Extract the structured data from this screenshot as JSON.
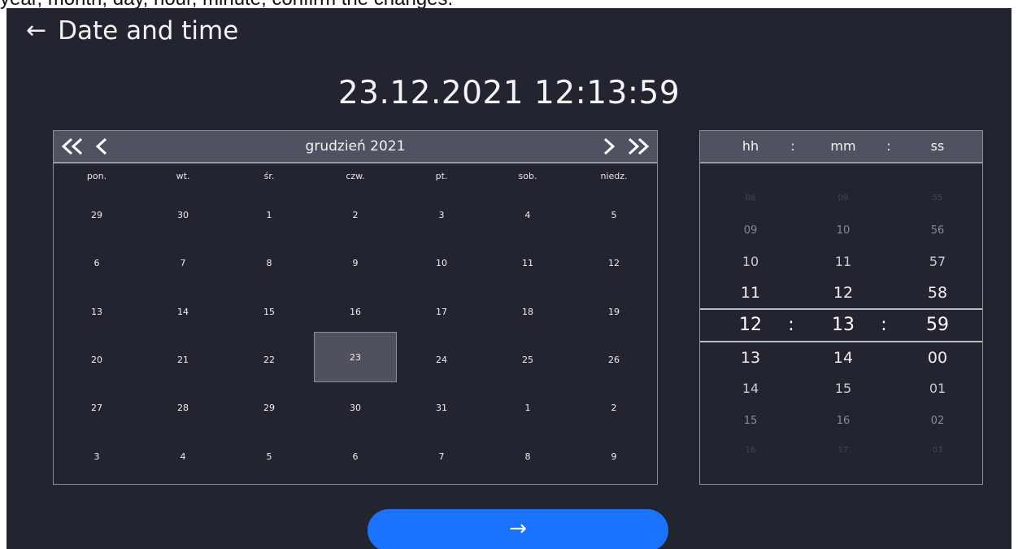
{
  "caption": "year, month, day, hour, minute, confirm the changes.",
  "header": {
    "back_icon": "←",
    "title": "Date and time"
  },
  "current_datetime": "23.12.2021 12:13:59",
  "calendar": {
    "month_label": "grudzień 2021",
    "weekdays": [
      "pon.",
      "wt.",
      "śr.",
      "czw.",
      "pt.",
      "sob.",
      "niedz."
    ],
    "days": [
      "29",
      "30",
      "1",
      "2",
      "3",
      "4",
      "5",
      "6",
      "7",
      "8",
      "9",
      "10",
      "11",
      "12",
      "13",
      "14",
      "15",
      "16",
      "17",
      "18",
      "19",
      "20",
      "21",
      "22",
      "23",
      "24",
      "25",
      "26",
      "27",
      "28",
      "29",
      "30",
      "31",
      "1",
      "2",
      "3",
      "4",
      "5",
      "6",
      "7",
      "8",
      "9"
    ],
    "selected_index": 24
  },
  "time": {
    "headers": {
      "hh": "hh",
      "mm": "mm",
      "ss": "ss",
      "sep": ":"
    },
    "rows": [
      [
        "08",
        "09",
        "55"
      ],
      [
        "09",
        "10",
        "56"
      ],
      [
        "10",
        "11",
        "57"
      ],
      [
        "11",
        "12",
        "58"
      ],
      [
        "12",
        "13",
        "59"
      ],
      [
        "13",
        "14",
        "00"
      ],
      [
        "14",
        "15",
        "01"
      ],
      [
        "15",
        "16",
        "02"
      ],
      [
        "16",
        "17",
        "03"
      ]
    ],
    "selected_row": 4
  },
  "confirm": {
    "label": "→"
  },
  "colors": {
    "background": "#222530",
    "header_bar": "#4f5361",
    "confirm": "#1a73ff"
  }
}
